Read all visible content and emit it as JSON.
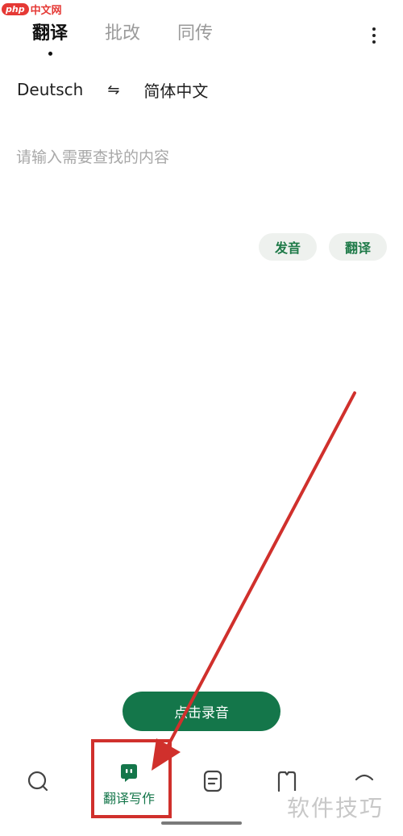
{
  "watermark": {
    "badge": "php",
    "site": "中文网",
    "corner": "软件技巧"
  },
  "header": {
    "tabs": [
      {
        "label": "翻译",
        "active": true
      },
      {
        "label": "批改",
        "active": false
      },
      {
        "label": "同传",
        "active": false
      }
    ],
    "more_icon": "more-vert-icon"
  },
  "languages": {
    "source": "Deutsch",
    "swap_symbol": "⇋",
    "target": "简体中文"
  },
  "input": {
    "placeholder": "请输入需要查找的内容"
  },
  "actions": {
    "speak_label": "发音",
    "translate_label": "翻译"
  },
  "record": {
    "label": "点击录音"
  },
  "bottom_nav": {
    "items": [
      {
        "icon": "search-icon",
        "label": ""
      },
      {
        "icon": "chat-bubble-icon",
        "label": "翻译写作",
        "active": true
      },
      {
        "icon": "note-icon",
        "label": ""
      },
      {
        "icon": "book-icon",
        "label": ""
      },
      {
        "icon": "profile-icon",
        "label": ""
      }
    ]
  },
  "colors": {
    "accent": "#14764a",
    "annotation": "#d0302c"
  }
}
